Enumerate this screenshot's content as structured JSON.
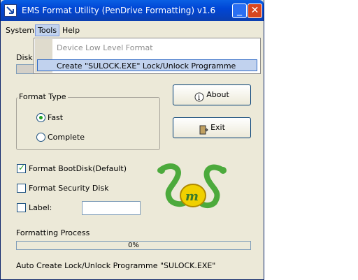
{
  "window": {
    "title": "EMS Format Utility (PenDrive Formatting) v1.6"
  },
  "menu": {
    "system": "System",
    "tools": "Tools",
    "help": "Help"
  },
  "tools_menu": {
    "items": [
      {
        "label": "Device Low Level Format",
        "enabled": false
      },
      {
        "label": "Create \"SULOCK.EXE\" Lock/Unlock Programme",
        "enabled": true,
        "highlighted": true
      }
    ]
  },
  "disk": {
    "label": "Disk"
  },
  "format_type": {
    "label": "Format Type",
    "options": [
      {
        "label": "Fast",
        "selected": true
      },
      {
        "label": "Complete",
        "selected": false
      }
    ]
  },
  "buttons": {
    "about": "About",
    "exit": "Exit"
  },
  "checkboxes": {
    "bootdisk": {
      "label": "Format BootDisk(Default)",
      "checked": true
    },
    "security": {
      "label": "Format Security Disk",
      "checked": false
    },
    "label": {
      "label": "Label:",
      "checked": false
    }
  },
  "label_input": {
    "value": ""
  },
  "progress": {
    "label": "Formatting Process",
    "percent": 0,
    "text": "0%"
  },
  "status": {
    "text": "Auto Create Lock/Unlock Programme \"SULOCK.EXE\""
  },
  "colors": {
    "title_bar": "#0a5fe4",
    "window_bg": "#ece9d8",
    "highlight": "#c1d2ee",
    "dragon": "#5cb85c",
    "logo": "#f0d000"
  }
}
